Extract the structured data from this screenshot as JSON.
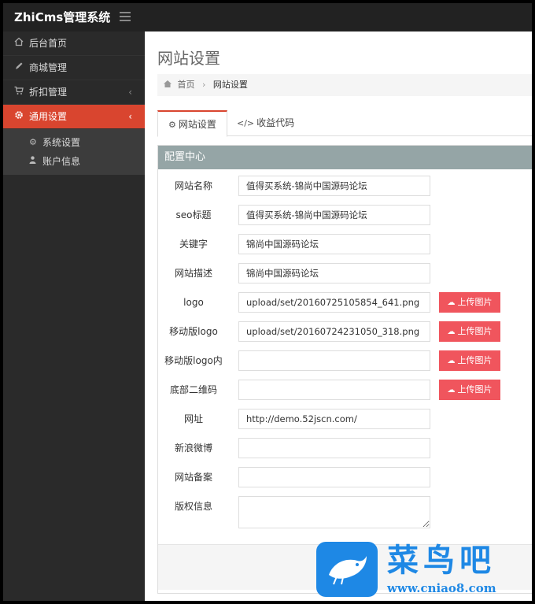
{
  "app": {
    "title": "ZhiCms管理系统"
  },
  "sidebar": {
    "items": [
      {
        "label": "后台首页",
        "icon": "home-icon"
      },
      {
        "label": "商城管理",
        "icon": "pencil-icon"
      },
      {
        "label": "折扣管理",
        "icon": "cart-icon"
      },
      {
        "label": "通用设置",
        "icon": "gear-icon"
      }
    ],
    "subitems": [
      {
        "label": "系统设置",
        "icon": "gears-icon"
      },
      {
        "label": "账户信息",
        "icon": "user-icon"
      }
    ],
    "colors": {
      "active": "#d9452f",
      "background": "#2a2a2a"
    }
  },
  "main": {
    "title": "网站设置",
    "breadcrumb": {
      "home": "首页",
      "current": "网站设置"
    },
    "tabs": [
      {
        "label": "网站设置",
        "icon": "gears-icon"
      },
      {
        "label": "收益代码",
        "icon": "code-icon"
      }
    ],
    "panel": {
      "heading": "配置中心",
      "upload_label": "上传图片",
      "fields": [
        {
          "label": "网站名称",
          "value": "值得买系统-锦尚中国源码论坛"
        },
        {
          "label": "seo标题",
          "value": "值得买系统-锦尚中国源码论坛"
        },
        {
          "label": "关键字",
          "value": "锦尚中国源码论坛"
        },
        {
          "label": "网站描述",
          "value": "锦尚中国源码论坛"
        },
        {
          "label": "logo",
          "value": "upload/set/20160725105854_641.png"
        },
        {
          "label": "移动版logo",
          "value": "upload/set/20160724231050_318.png"
        },
        {
          "label": "移动版logo内",
          "value": ""
        },
        {
          "label": "底部二维码",
          "value": ""
        },
        {
          "label": "网址",
          "value": "http://demo.52jscn.com/"
        },
        {
          "label": "新浪微博",
          "value": ""
        },
        {
          "label": "网站备案",
          "value": ""
        },
        {
          "label": "版权信息",
          "value": ""
        }
      ]
    }
  },
  "watermark": {
    "name": "菜鸟吧",
    "url": "www.cniao8.com"
  }
}
